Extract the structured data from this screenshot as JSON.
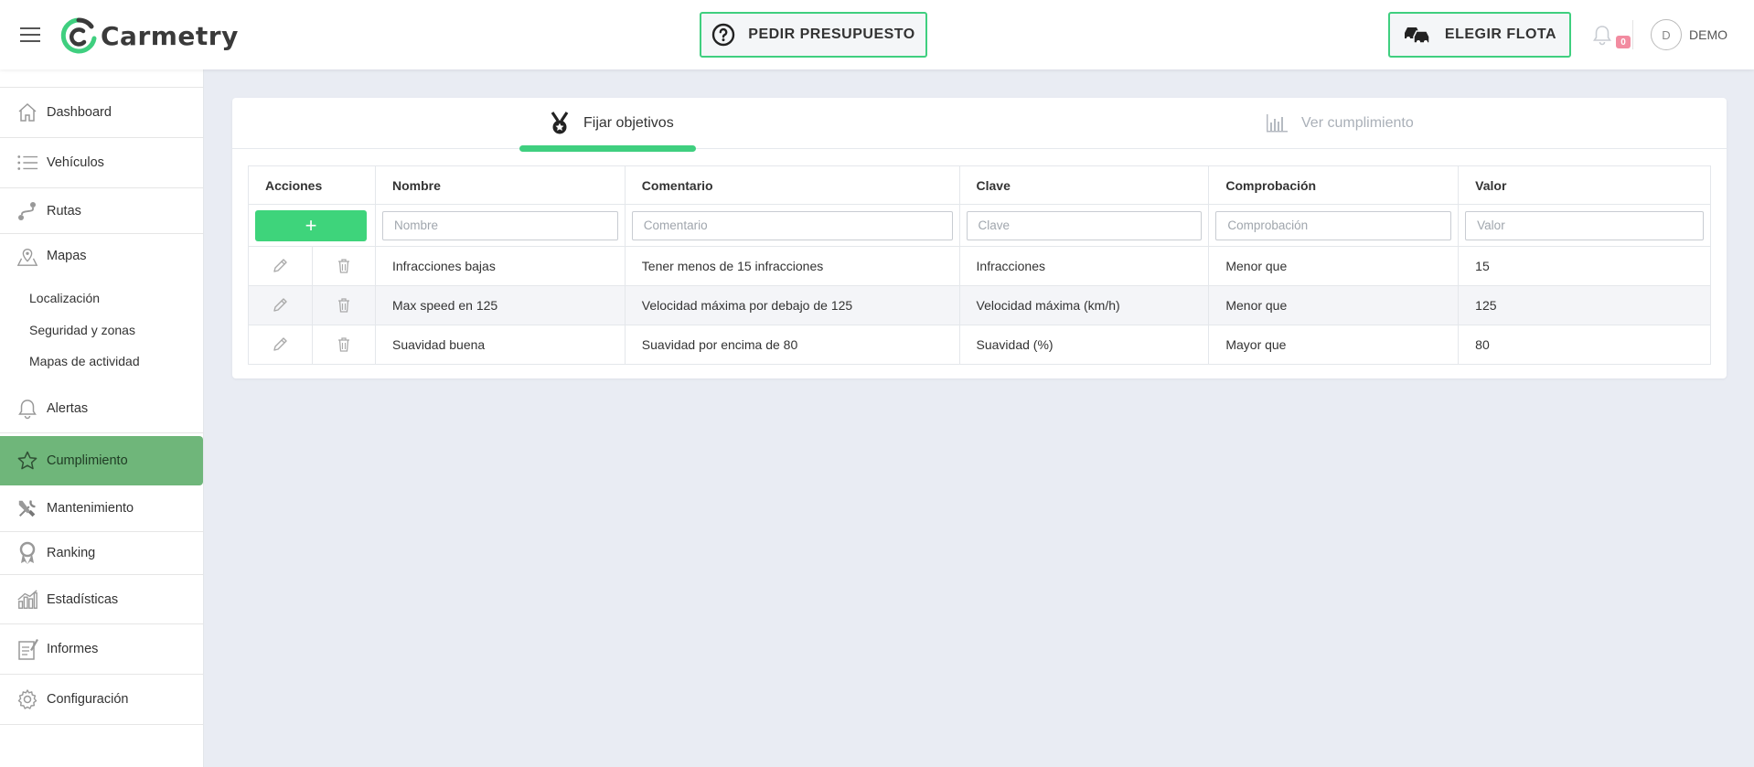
{
  "header": {
    "brand": "Carmetry",
    "quote_button": "PEDIR PRESUPUESTO",
    "fleet_button": "ELEGIR FLOTA",
    "notification_count": "0",
    "avatar_initial": "D",
    "username": "DEMO"
  },
  "sidebar": {
    "items": [
      {
        "label": "Dashboard",
        "icon": "home-icon"
      },
      {
        "label": "Vehículos",
        "icon": "list-icon"
      },
      {
        "label": "Rutas",
        "icon": "route-icon"
      },
      {
        "label": "Mapas",
        "icon": "map-icon"
      },
      {
        "label": "Alertas",
        "icon": "bell-icon"
      },
      {
        "label": "Cumplimiento",
        "icon": "star-icon"
      },
      {
        "label": "Mantenimiento",
        "icon": "tools-icon"
      },
      {
        "label": "Ranking",
        "icon": "medal-icon"
      },
      {
        "label": "Estadísticas",
        "icon": "bar-chart-icon"
      },
      {
        "label": "Informes",
        "icon": "report-icon"
      },
      {
        "label": "Configuración",
        "icon": "gear-icon"
      }
    ],
    "map_subitems": [
      "Localización",
      "Seguridad y zonas",
      "Mapas de actividad"
    ],
    "active": "Cumplimiento"
  },
  "tabs": {
    "set_goals": "Fijar objetivos",
    "view_compliance": "Ver cumplimiento"
  },
  "table": {
    "headers": [
      "Acciones",
      "Nombre",
      "Comentario",
      "Clave",
      "Comprobación",
      "Valor"
    ],
    "filters": {
      "nombre": "Nombre",
      "comentario": "Comentario",
      "clave": "Clave",
      "comprobacion": "Comprobación",
      "valor": "Valor"
    },
    "add_label": "+",
    "rows": [
      {
        "nombre": "Infracciones bajas",
        "comentario": "Tener menos de 15 infracciones",
        "clave": "Infracciones",
        "comprobacion": "Menor que",
        "valor": "15"
      },
      {
        "nombre": "Max speed en 125",
        "comentario": "Velocidad máxima por debajo de 125",
        "clave": "Velocidad máxima (km/h)",
        "comprobacion": "Menor que",
        "valor": "125"
      },
      {
        "nombre": "Suavidad buena",
        "comentario": "Suavidad por encima de 80",
        "clave": "Suavidad (%)",
        "comprobacion": "Mayor que",
        "valor": "80"
      }
    ]
  },
  "colors": {
    "accent": "#3fcf7f",
    "active_nav": "#6fb67a",
    "badge": "#f28ba0",
    "background": "#e9ecf3"
  }
}
